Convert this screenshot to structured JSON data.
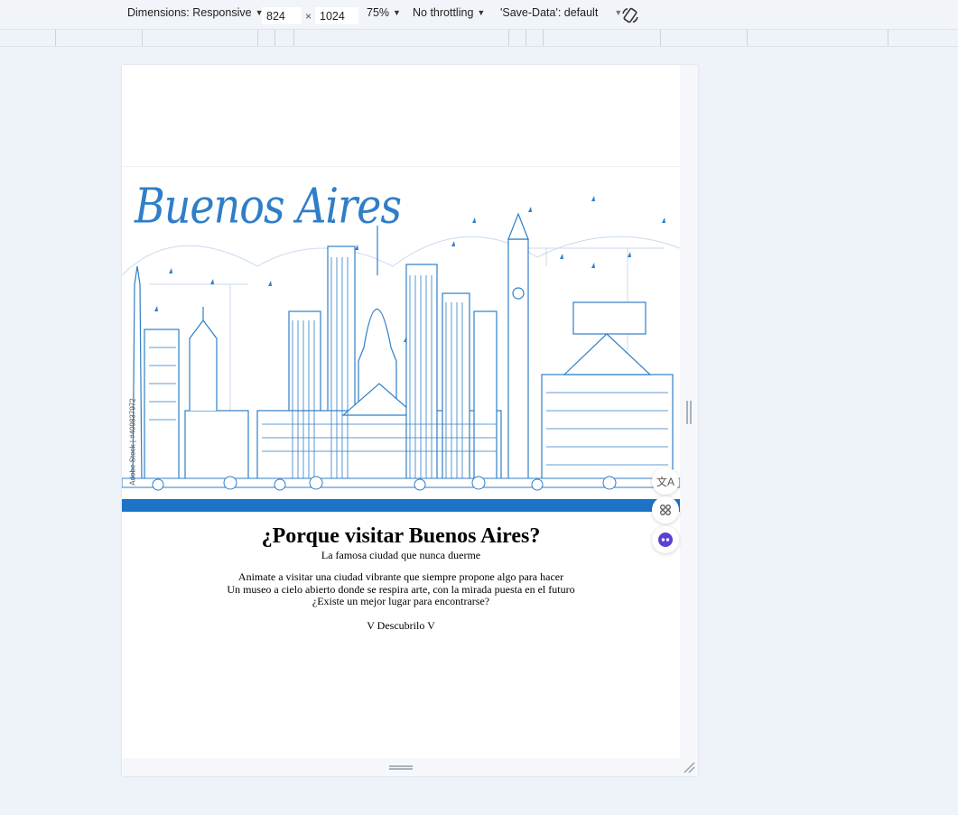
{
  "toolbar": {
    "dimensions_label": "Dimensions: Responsive",
    "width_value": "824",
    "height_value": "1024",
    "separator": "×",
    "zoom": "75%",
    "throttling": "No throttling",
    "save_data": "'Save-Data': default",
    "caret": "▼"
  },
  "banner": {
    "title": "Buenos Aires",
    "credit": "Adobe Stock | #409837972"
  },
  "page": {
    "heading": "¿Porque visitar Buenos Aires?",
    "subtitle": "La famosa ciudad que nunca duerme",
    "lines": [
      "Animate a visitar una ciudad vibrante que siempre propone algo para hacer",
      "Un museo a cielo abierto donde se respira arte, con la mirada puesta en el futuro",
      "¿Existe un mejor lugar para encontrarse?"
    ],
    "cta": "V Descubrilo V"
  },
  "colors": {
    "accent": "#2f7ec8",
    "skyline_fill": "#1b74c5",
    "background": "#eef2f9"
  }
}
